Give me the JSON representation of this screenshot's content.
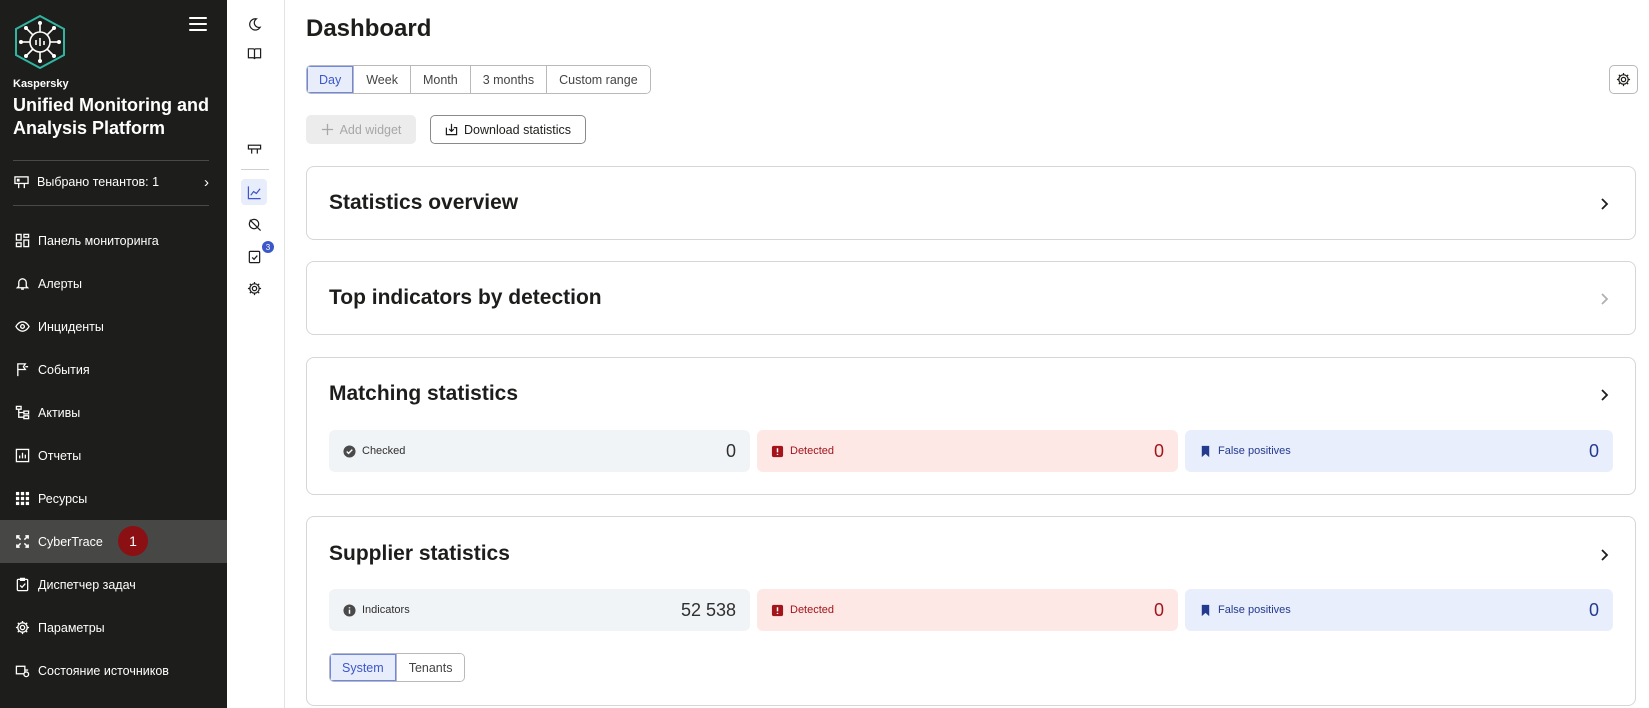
{
  "brand": {
    "vendor": "Kaspersky",
    "product": "Unified Monitoring and Analysis Platform"
  },
  "tenant_selector": {
    "label": "Выбрано тенантов: 1"
  },
  "nav": [
    {
      "label": "Панель мониторинга",
      "icon": "dashboard-icon"
    },
    {
      "label": "Алерты",
      "icon": "bell-icon"
    },
    {
      "label": "Инциденты",
      "icon": "eye-icon"
    },
    {
      "label": "События",
      "icon": "flag-icon"
    },
    {
      "label": "Активы",
      "icon": "tree-icon"
    },
    {
      "label": "Отчеты",
      "icon": "report-icon"
    },
    {
      "label": "Ресурсы",
      "icon": "grid-icon"
    },
    {
      "label": "CyberTrace",
      "icon": "cybertrace-icon",
      "badge": "1",
      "active": true
    },
    {
      "label": "Диспетчер задач",
      "icon": "tasks-icon"
    },
    {
      "label": "Параметры",
      "icon": "gear-icon"
    },
    {
      "label": "Состояние источников",
      "icon": "source-icon"
    }
  ],
  "rail": {
    "tasks_badge": "3"
  },
  "page": {
    "title": "Dashboard"
  },
  "period": {
    "options": [
      "Day",
      "Week",
      "Month",
      "3 months",
      "Custom range"
    ],
    "selected": "Day"
  },
  "toolbar": {
    "add_widget": "Add widget",
    "download": "Download statistics"
  },
  "cards": {
    "overview": {
      "title": "Statistics overview"
    },
    "top": {
      "title": "Top indicators by detection"
    },
    "matching": {
      "title": "Matching statistics",
      "checked_label": "Checked",
      "checked_value": "0",
      "detected_label": "Detected",
      "detected_value": "0",
      "fp_label": "False positives",
      "fp_value": "0"
    },
    "supplier": {
      "title": "Supplier statistics",
      "indicators_label": "Indicators",
      "indicators_value": "52 538",
      "detected_label": "Detected",
      "detected_value": "0",
      "fp_label": "False positives",
      "fp_value": "0",
      "scope_options": [
        "System",
        "Tenants"
      ],
      "scope_selected": "System"
    }
  },
  "colors": {
    "sidebar_bg": "#1d1d1b",
    "accent": "#3c57c9",
    "badge_red": "#8b1014",
    "detected_red": "#a3141b"
  }
}
